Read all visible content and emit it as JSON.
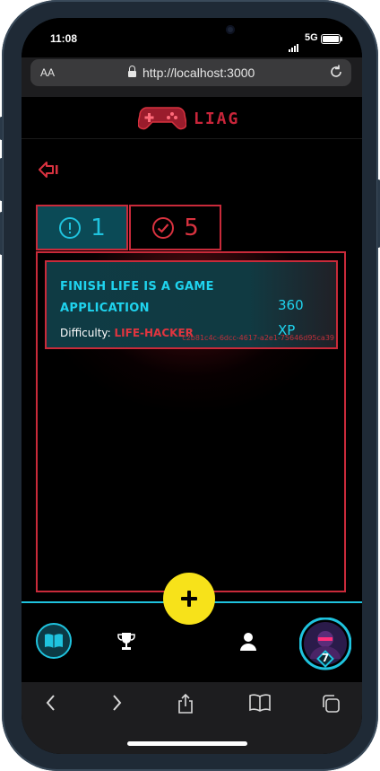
{
  "status_bar": {
    "time": "11:08",
    "network": "5G"
  },
  "browser": {
    "text_size_label": "AA",
    "url": "http://localhost:3000"
  },
  "app": {
    "logo_text": "LIAG",
    "tabs": [
      {
        "count": "1",
        "icon": "alert-circle-icon"
      },
      {
        "count": "5",
        "icon": "check-circle-icon"
      }
    ],
    "quest": {
      "title": "FINISH LIFE IS A GAME APPLICATION",
      "difficulty_label": "Difficulty:",
      "difficulty_value": "LIFE-HACKER",
      "xp_value": "360",
      "xp_unit": "XP",
      "id": "c2b81c4c-6dcc-4617-a2e1-75646d95ca39"
    },
    "avatar_level": "7"
  },
  "colors": {
    "cyan": "#1fc3de",
    "red": "#c92a3a",
    "yellow": "#f7e21a",
    "teal_dark": "#0b4a56"
  }
}
